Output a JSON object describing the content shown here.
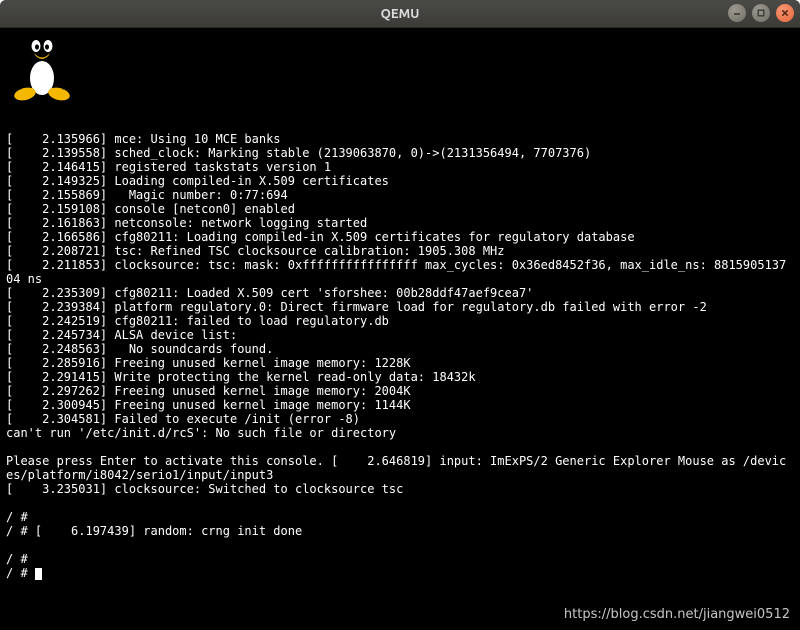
{
  "window": {
    "title": "QEMU"
  },
  "log_lines": [
    "[    2.135966] mce: Using 10 MCE banks",
    "[    2.139558] sched_clock: Marking stable (2139063870, 0)->(2131356494, 7707376)",
    "[    2.146415] registered taskstats version 1",
    "[    2.149325] Loading compiled-in X.509 certificates",
    "[    2.155869]   Magic number: 0:77:694",
    "[    2.159108] console [netcon0] enabled",
    "[    2.161863] netconsole: network logging started",
    "[    2.166586] cfg80211: Loading compiled-in X.509 certificates for regulatory database",
    "[    2.208721] tsc: Refined TSC clocksource calibration: 1905.308 MHz",
    "[    2.211853] clocksource: tsc: mask: 0xffffffffffffffff max_cycles: 0x36ed8452f36, max_idle_ns: 881590513704 ns",
    "[    2.235309] cfg80211: Loaded X.509 cert 'sforshee: 00b28ddf47aef9cea7'",
    "[    2.239384] platform regulatory.0: Direct firmware load for regulatory.db failed with error -2",
    "[    2.242519] cfg80211: failed to load regulatory.db",
    "[    2.245734] ALSA device list:",
    "[    2.248563]   No soundcards found.",
    "[    2.285916] Freeing unused kernel image memory: 1228K",
    "[    2.291415] Write protecting the kernel read-only data: 18432k",
    "[    2.297262] Freeing unused kernel image memory: 2004K",
    "[    2.300945] Freeing unused kernel image memory: 1144K",
    "[    2.304581] Failed to execute /init (error -8)",
    "can't run '/etc/init.d/rcS': No such file or directory",
    "",
    "Please press Enter to activate this console. [    2.646819] input: ImExPS/2 Generic Explorer Mouse as /devices/platform/i8042/serio1/input/input3",
    "[    3.235031] clocksource: Switched to clocksource tsc",
    "",
    "/ #",
    "/ # [    6.197439] random: crng init done",
    "",
    "/ #"
  ],
  "prompt": "/ # ",
  "watermark": "https://blog.csdn.net/jiangwei0512",
  "icons": {
    "tux": "tux-penguin-icon",
    "minimize": "minimize-icon",
    "maximize": "maximize-icon",
    "close": "close-icon"
  }
}
